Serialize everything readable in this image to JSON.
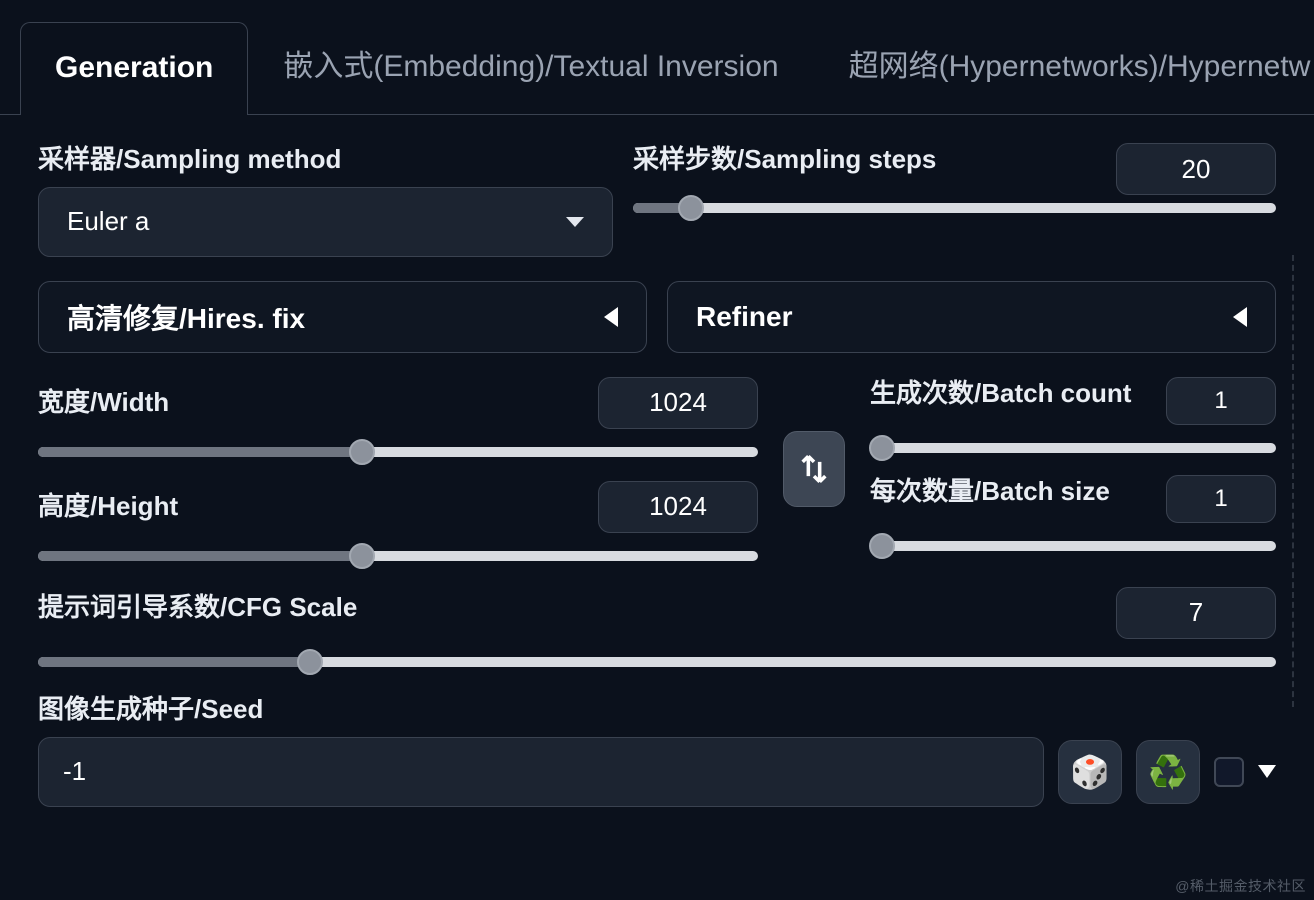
{
  "tabs": {
    "generation": "Generation",
    "textual_inversion": "嵌入式(Embedding)/Textual Inversion",
    "hypernetworks": "超网络(Hypernetworks)/Hypernetw"
  },
  "sampling_method": {
    "label": "采样器/Sampling method",
    "value": "Euler a"
  },
  "sampling_steps": {
    "label": "采样步数/Sampling steps",
    "value": "20",
    "percent": 9
  },
  "hires_fix": {
    "label": "高清修复/Hires. fix"
  },
  "refiner": {
    "label": "Refiner"
  },
  "width": {
    "label": "宽度/Width",
    "value": "1024",
    "percent": 45
  },
  "height": {
    "label": "高度/Height",
    "value": "1024",
    "percent": 45
  },
  "batch_count": {
    "label": "生成次数/Batch count",
    "value": "1",
    "percent": 0
  },
  "batch_size": {
    "label": "每次数量/Batch size",
    "value": "1",
    "percent": 0
  },
  "cfg": {
    "label": "提示词引导系数/CFG Scale",
    "value": "7",
    "percent": 22
  },
  "seed": {
    "label": "图像生成种子/Seed",
    "value": "-1"
  },
  "icons": {
    "dice": "🎲",
    "recycle": "♻️"
  },
  "watermark": "@稀土掘金技术社区"
}
